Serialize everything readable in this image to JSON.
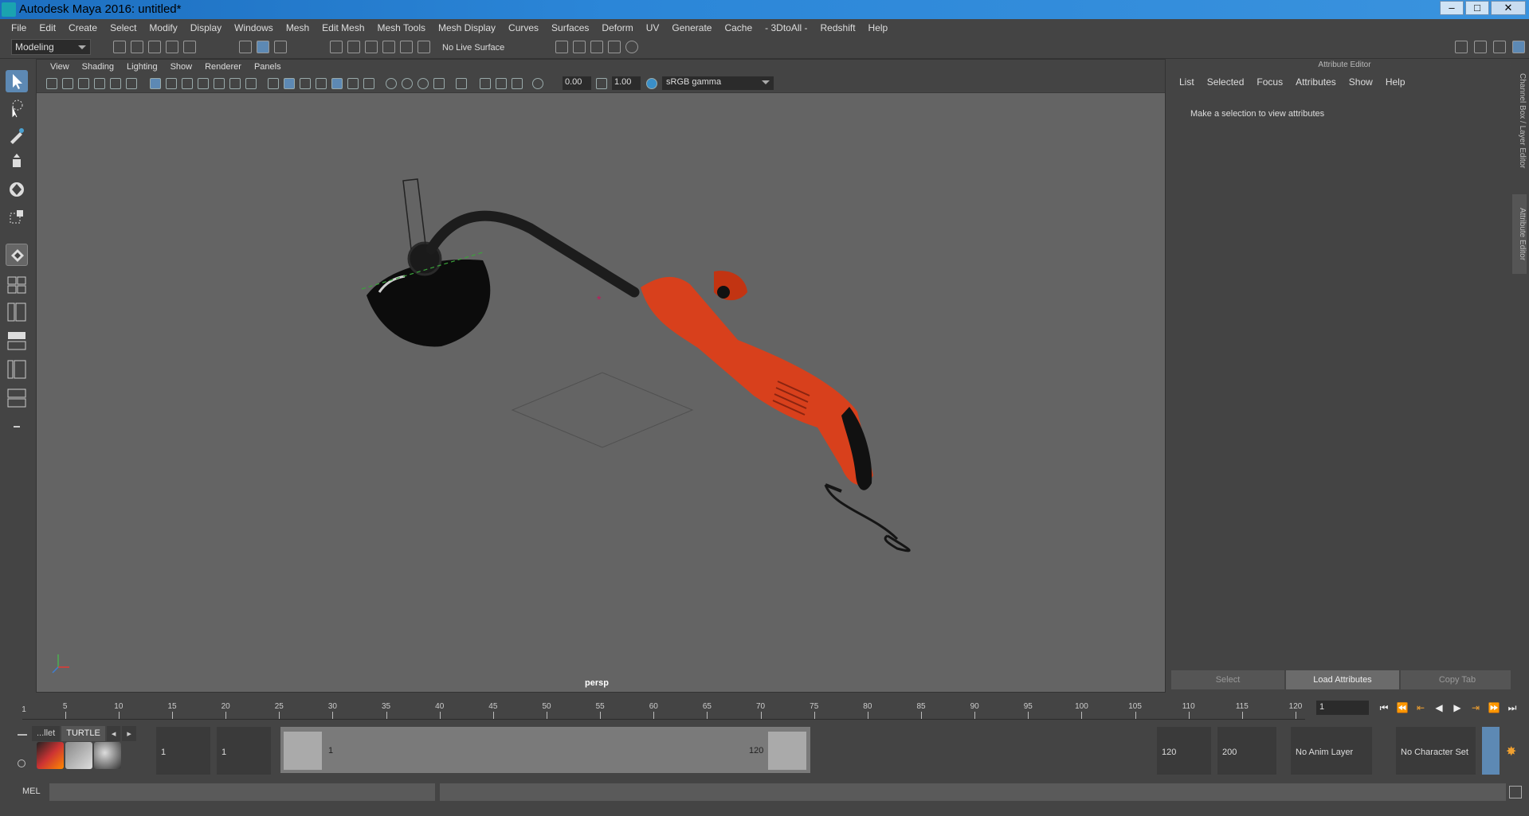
{
  "window": {
    "title": "Autodesk Maya 2016: untitled*",
    "minimize": "–",
    "restore": "□",
    "close": "✕"
  },
  "menubar": [
    "File",
    "Edit",
    "Create",
    "Select",
    "Modify",
    "Display",
    "Windows",
    "Mesh",
    "Edit Mesh",
    "Mesh Tools",
    "Mesh Display",
    "Curves",
    "Surfaces",
    "Deform",
    "UV",
    "Generate",
    "Cache",
    "- 3DtoAll -",
    "Redshift",
    "Help"
  ],
  "toolbar": {
    "mode": "Modeling",
    "live_surface": "No Live Surface"
  },
  "viewport": {
    "menus": [
      "View",
      "Shading",
      "Lighting",
      "Show",
      "Renderer",
      "Panels"
    ],
    "exposure": "0.00",
    "gamma": "1.00",
    "color_space": "sRGB gamma",
    "camera": "persp"
  },
  "attribute_editor": {
    "header": "Attribute Editor",
    "menus": [
      "List",
      "Selected",
      "Focus",
      "Attributes",
      "Show",
      "Help"
    ],
    "message": "Make a selection to view attributes",
    "buttons": [
      "Select",
      "Load Attributes",
      "Copy Tab"
    ]
  },
  "side_tabs": [
    "Channel Box / Layer Editor",
    "Attribute Editor"
  ],
  "timeline": {
    "ticks": [
      "5",
      "10",
      "15",
      "20",
      "25",
      "30",
      "35",
      "40",
      "45",
      "50",
      "55",
      "60",
      "65",
      "70",
      "75",
      "80",
      "85",
      "90",
      "95",
      "100",
      "105",
      "110",
      "115",
      "120"
    ],
    "start_label": "1",
    "current_frame": "1"
  },
  "range": {
    "shelf_tabs": [
      "...llet",
      "TURTLE"
    ],
    "start": "1",
    "playback_start": "1",
    "slider_start": "1",
    "slider_end": "120",
    "playback_end": "120",
    "end": "200",
    "anim_layer": "No Anim Layer",
    "character_set": "No Character Set"
  },
  "command_line": {
    "label": "MEL"
  },
  "colors": {
    "accent": "#5d89b4",
    "trimmer_body": "#d8401c",
    "trimmer_dark": "#111111"
  }
}
